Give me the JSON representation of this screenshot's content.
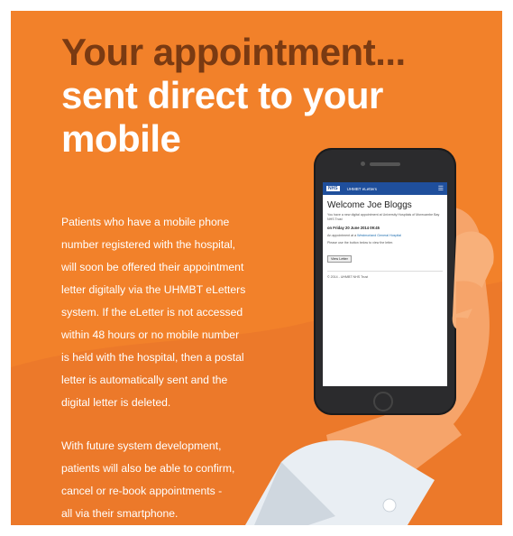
{
  "headline": {
    "line1": "Your appointment...",
    "line2a": "sent direct to your",
    "line2b": "mobile"
  },
  "body": {
    "paragraph1_lines": [
      "Patients who have a mobile phone",
      "number registered with the hospital,",
      "will soon be offered their appointment",
      "letter digitally via the UHMBT eLetters",
      "system. If the eLetter is not accessed",
      "within 48 hours or no mobile number",
      "is held with the hospital, then a postal",
      "letter is automatically sent and the",
      "digital letter is deleted."
    ],
    "paragraph2_lines": [
      "With future system development,",
      "patients will also be able to confirm,",
      "cancel or re-book appointments -",
      "all via their smartphone."
    ]
  },
  "phone_screen": {
    "logo": "NHS",
    "header_title": "UHMBT eLetters",
    "menu_icon": "☰",
    "welcome": "Welcome Joe Bloggs",
    "intro": "You have a new digital appointment at University Hospitals of Morecambe Bay NHS Trust",
    "date_line": "on Friday 20 June 2014 09:45",
    "location_text": "An appointment at a",
    "location_link": "Westmorland General Hospital",
    "instruction": "Please use the button below to view the letter.",
    "view_button": "View Letter",
    "footer": "© 2014 - UHMBT NHS Trust"
  },
  "colors": {
    "poster_bg": "#f2812a",
    "headline_dark": "#7a3a12",
    "nhs_blue": "#1f4f9c",
    "skin": "#f6a46a",
    "sleeve": "#e9eef3"
  }
}
